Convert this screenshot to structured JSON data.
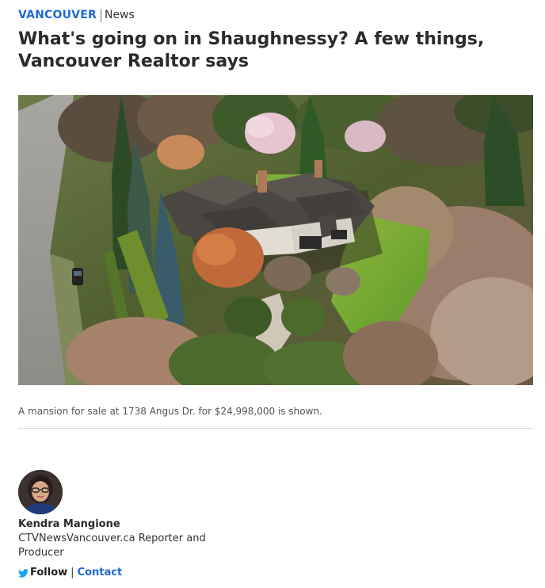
{
  "kicker": {
    "region": "VANCOUVER",
    "section": "News"
  },
  "article": {
    "headline": "What's going on in Shaughnessy? A few things, Vancouver Realtor says",
    "caption": "A mansion for sale at 1738 Angus Dr. for $24,998,000 is shown."
  },
  "author": {
    "name": "Kendra Mangione",
    "title": "CTVNewsVancouver.ca Reporter and Producer",
    "follow_label": "Follow",
    "separator": "|",
    "contact_label": "Contact"
  },
  "colors": {
    "accent": "#1e68d6",
    "twitter": "#1da1f2"
  },
  "icons": {
    "follow": "twitter-icon"
  }
}
